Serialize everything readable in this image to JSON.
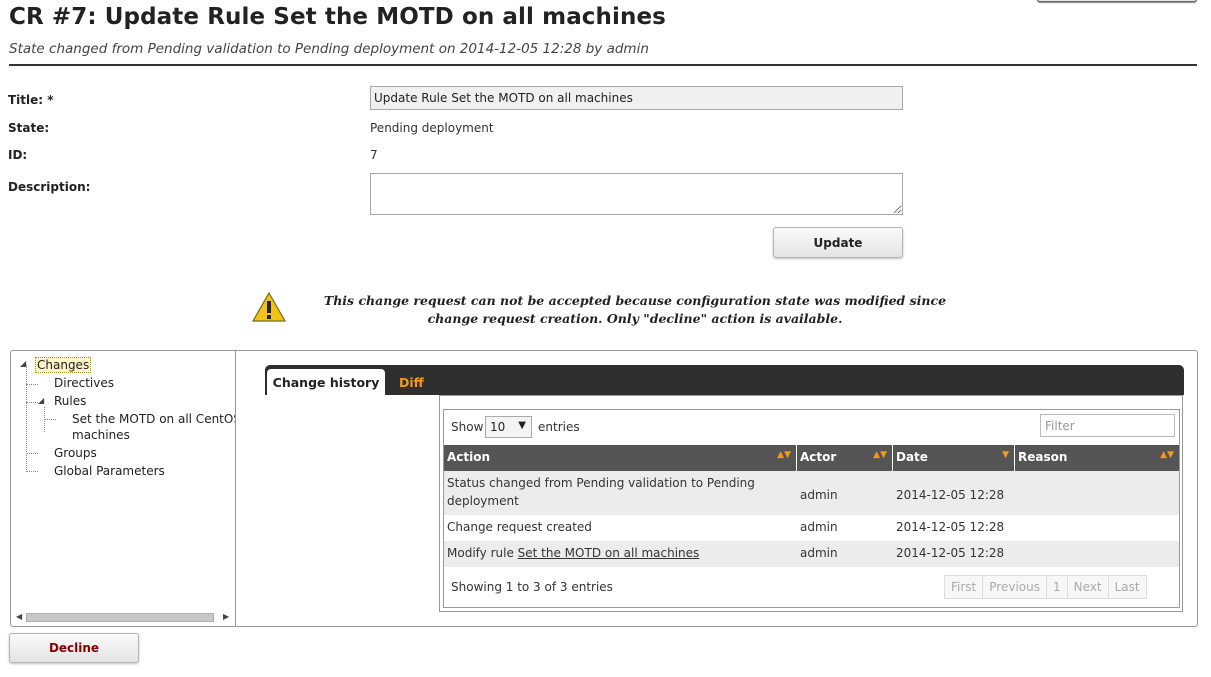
{
  "header": {
    "title": "CR #7: Update Rule Set the MOTD on all machines",
    "subtitle": "State changed from Pending validation to Pending deployment on 2014-12-05 12:28 by admin"
  },
  "form": {
    "title_label": "Title: *",
    "title_value": "Update Rule Set the MOTD on all machines",
    "state_label": "State:",
    "state_value": "Pending deployment",
    "id_label": "ID:",
    "id_value": "7",
    "description_label": "Description:",
    "description_value": "",
    "update_label": "Update"
  },
  "warning": {
    "icon": "warning-icon",
    "text": "This change request can not be accepted because configuration state was modified since change request creation. Only \"decline\" action is available."
  },
  "tree": {
    "root": "Changes",
    "directives": "Directives",
    "rules": "Rules",
    "rule_item_line1": "Set the MOTD on all CentOS",
    "rule_item_line2": "machines",
    "groups": "Groups",
    "global_parameters": "Global Parameters"
  },
  "tabs": {
    "history": "Change history",
    "diff": "Diff"
  },
  "table": {
    "show_label": "Show",
    "page_size": "10",
    "entries_label": "entries",
    "filter_placeholder": "Filter",
    "columns": [
      "Action",
      "Actor",
      "Date",
      "Reason"
    ],
    "rows": [
      {
        "action": "Status changed from Pending validation to Pending deployment",
        "actor": "admin",
        "date": "2014-12-05 12:28",
        "reason": ""
      },
      {
        "action": "Change request created",
        "actor": "admin",
        "date": "2014-12-05 12:28",
        "reason": ""
      },
      {
        "action_prefix": "Modify rule ",
        "action_link": "Set the MOTD on all machines",
        "actor": "admin",
        "date": "2014-12-05 12:28",
        "reason": ""
      }
    ],
    "showing": "Showing 1 to 3 of 3 entries",
    "pager": {
      "first": "First",
      "previous": "Previous",
      "page": "1",
      "next": "Next",
      "last": "Last"
    }
  },
  "actions": {
    "decline_label": "Decline"
  },
  "colors": {
    "accent_orange": "#f39a1c",
    "tabbar_dark": "#2f2f2f",
    "table_header": "#555555",
    "decline_text": "#8b0000"
  }
}
